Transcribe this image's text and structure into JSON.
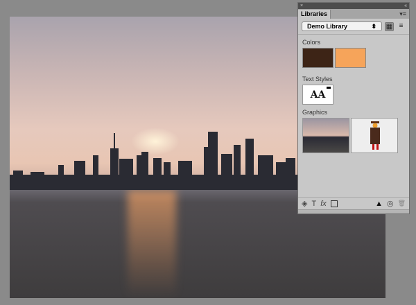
{
  "panel": {
    "tab": "Libraries",
    "library_select": "Demo Library",
    "sections": {
      "colors": "Colors",
      "text_styles": "Text Styles",
      "graphics": "Graphics"
    },
    "text_style_sample": "AA",
    "colors": [
      "#3d2416",
      "#f6a45a"
    ]
  },
  "icons": {
    "close": "×",
    "collapse": "«",
    "menu": "▾≡",
    "select_arrow": "⬍",
    "grid": "▦",
    "list": "≡",
    "text": "T",
    "fx": "fx",
    "warning": "▲",
    "cc": "◎",
    "trash": "🗑"
  }
}
